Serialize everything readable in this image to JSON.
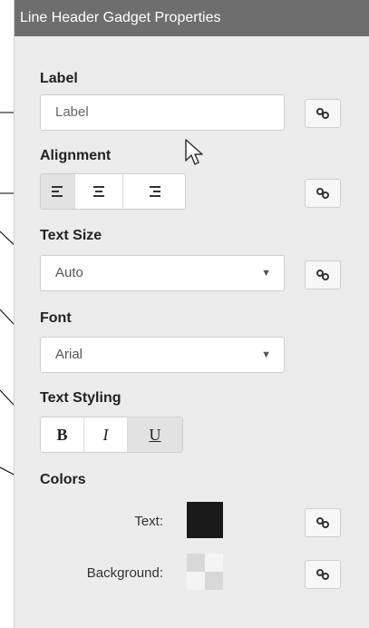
{
  "panel": {
    "title": "Line Header Gadget Properties"
  },
  "label_section": {
    "heading": "Label",
    "input_value": "Label"
  },
  "alignment_section": {
    "heading": "Alignment",
    "options": [
      "left",
      "center",
      "right"
    ],
    "selected": "left"
  },
  "text_size_section": {
    "heading": "Text Size",
    "selected": "Auto"
  },
  "font_section": {
    "heading": "Font",
    "selected": "Arial"
  },
  "text_styling_section": {
    "heading": "Text Styling",
    "bold": "B",
    "italic": "I",
    "underline": "U",
    "active": "underline"
  },
  "colors_section": {
    "heading": "Colors",
    "text_label": "Text:",
    "text_color": "#1a1a1a",
    "background_label": "Background:",
    "background_color": "transparent"
  }
}
